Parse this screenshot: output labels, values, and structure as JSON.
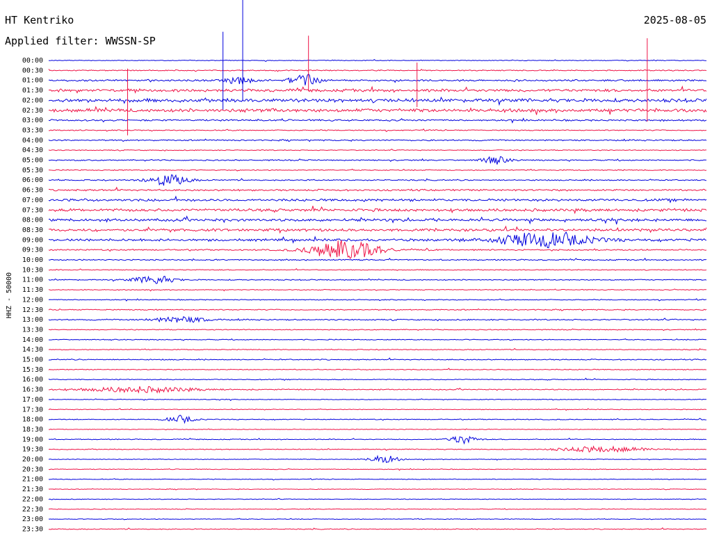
{
  "header": {
    "station": "HT Kentriko",
    "date": "2025-08-05",
    "filter": "Applied filter: WWSSN-SP"
  },
  "chart_data": {
    "type": "line",
    "title": "HT Kentriko",
    "ylabel": "HHZ - 50000",
    "tick_labels": [
      "00:00",
      "00:30",
      "01:00",
      "01:30",
      "02:00",
      "02:30",
      "03:00",
      "03:30",
      "04:00",
      "04:30",
      "05:00",
      "05:30",
      "06:00",
      "06:30",
      "07:00",
      "07:30",
      "08:00",
      "08:30",
      "09:00",
      "09:30",
      "10:00",
      "10:30",
      "11:00",
      "11:30",
      "12:00",
      "12:30",
      "13:00",
      "13:30",
      "14:00",
      "14:30",
      "15:00",
      "15:30",
      "16:00",
      "16:30",
      "17:00",
      "17:30",
      "18:00",
      "18:30",
      "19:00",
      "19:30",
      "20:00",
      "20:30",
      "21:00",
      "21:30",
      "22:00",
      "22:30",
      "23:00",
      "23:30"
    ],
    "colors": {
      "even": "#0000dd",
      "odd": "#ee1144"
    },
    "noise": [
      0.4,
      0.6,
      1.0,
      1.6,
      2.0,
      2.0,
      1.0,
      0.6,
      0.8,
      0.5,
      0.7,
      0.6,
      0.7,
      1.0,
      1.4,
      1.6,
      1.6,
      1.5,
      1.4,
      0.8,
      0.7,
      0.5,
      0.6,
      0.5,
      0.5,
      0.6,
      0.7,
      0.5,
      0.5,
      0.5,
      0.6,
      0.5,
      0.5,
      0.6,
      0.4,
      0.4,
      0.5,
      0.4,
      0.5,
      0.5,
      0.4,
      0.4,
      0.4,
      0.4,
      0.4,
      0.4,
      0.4,
      0.5
    ],
    "events": [
      {
        "row": 18,
        "t": 0.75,
        "amp": 10,
        "width": 0.07
      },
      {
        "row": 19,
        "t": 0.45,
        "amp": 14,
        "width": 0.05
      },
      {
        "row": 22,
        "t": 0.16,
        "amp": 6,
        "width": 0.03
      },
      {
        "row": 12,
        "t": 0.18,
        "amp": 8,
        "width": 0.03
      },
      {
        "row": 2,
        "t": 0.39,
        "amp": 10,
        "width": 0.02
      },
      {
        "row": 2,
        "t": 0.29,
        "amp": 5,
        "width": 0.02
      },
      {
        "row": 36,
        "t": 0.2,
        "amp": 5,
        "width": 0.02
      },
      {
        "row": 38,
        "t": 0.63,
        "amp": 6,
        "width": 0.02
      },
      {
        "row": 40,
        "t": 0.51,
        "amp": 6,
        "width": 0.02
      },
      {
        "row": 39,
        "t": 0.84,
        "amp": 4,
        "width": 0.06
      },
      {
        "row": 33,
        "t": 0.14,
        "amp": 4,
        "width": 0.08
      },
      {
        "row": 26,
        "t": 0.2,
        "amp": 4,
        "width": 0.04
      },
      {
        "row": 10,
        "t": 0.68,
        "amp": 5,
        "width": 0.02
      }
    ],
    "spikes": [
      {
        "row": 0,
        "t": 0.295,
        "amp": 95
      },
      {
        "row": 2,
        "t": 0.265,
        "amp": 70
      },
      {
        "row": 3,
        "t": 0.91,
        "amp": 75
      },
      {
        "row": 5,
        "t": 0.12,
        "amp": 60
      },
      {
        "row": 1,
        "t": 0.395,
        "amp": 50
      },
      {
        "row": 3,
        "t": 0.56,
        "amp": 40
      }
    ]
  }
}
